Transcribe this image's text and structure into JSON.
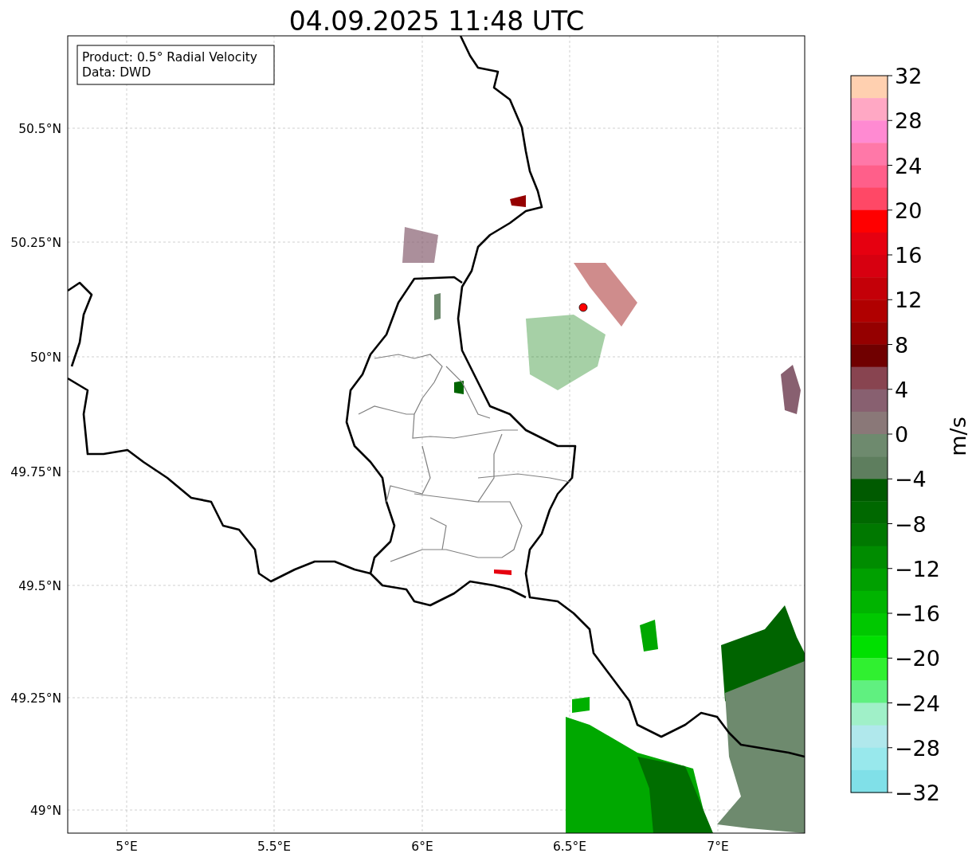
{
  "title": "04.09.2025 11:48 UTC",
  "info_box": [
    "Product: 0.5° Radial Velocity",
    "Data: DWD"
  ],
  "lat_labels": [
    "50.5°N",
    "50.25°N",
    "50°N",
    "49.75°N",
    "49.5°N",
    "49.25°N",
    "49°N"
  ],
  "lon_labels": [
    "5°E",
    "5.5°E",
    "6°E",
    "6.5°E",
    "7°E"
  ],
  "colorbar": {
    "label": "m/s",
    "ticks": [
      "32",
      "28",
      "24",
      "20",
      "16",
      "12",
      "8",
      "4",
      "0",
      "−4",
      "−8",
      "−12",
      "−16",
      "−20",
      "−24",
      "−28",
      "−32"
    ],
    "segments": [
      {
        "color": "#ffd0b0"
      },
      {
        "color": "#ffa8c4"
      },
      {
        "color": "#ff8ad2"
      },
      {
        "color": "#ff78a8"
      },
      {
        "color": "#ff5f8a"
      },
      {
        "color": "#ff4866"
      },
      {
        "color": "#ff0000"
      },
      {
        "color": "#e60010"
      },
      {
        "color": "#d70010"
      },
      {
        "color": "#c40008"
      },
      {
        "color": "#b00000"
      },
      {
        "color": "#950000"
      },
      {
        "color": "#700000"
      },
      {
        "color": "#884450"
      },
      {
        "color": "#886070"
      },
      {
        "color": "#8a7878"
      },
      {
        "color": "#6e8a6e"
      },
      {
        "color": "#5e7e5e"
      },
      {
        "color": "#005a00"
      },
      {
        "color": "#006800"
      },
      {
        "color": "#007800"
      },
      {
        "color": "#008c00"
      },
      {
        "color": "#00a000"
      },
      {
        "color": "#00b400"
      },
      {
        "color": "#00c800"
      },
      {
        "color": "#00e000"
      },
      {
        "color": "#30f030"
      },
      {
        "color": "#60f080"
      },
      {
        "color": "#a0f0c8"
      },
      {
        "color": "#b0e8ec"
      },
      {
        "color": "#98e8ec"
      },
      {
        "color": "#80e0e8"
      }
    ]
  }
}
